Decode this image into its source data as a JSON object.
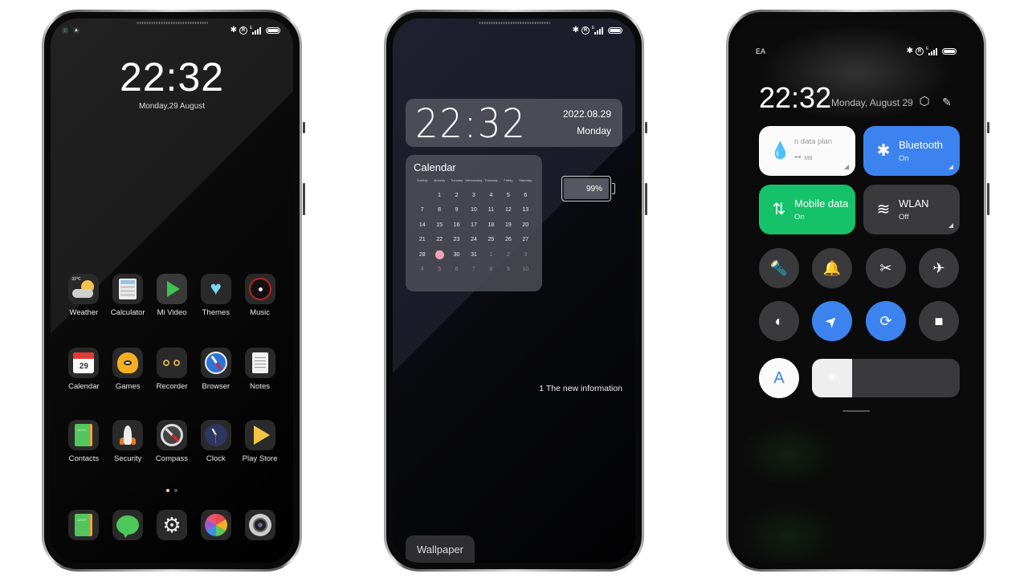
{
  "status_bar": {
    "bluetooth_icon": "bluetooth-icon",
    "registered_icon": "R",
    "network_type": "E",
    "battery_icon": "battery-icon"
  },
  "home_screen": {
    "notifications": [
      "phone-icon",
      "bell-icon"
    ],
    "clock": "22:32",
    "date": "Monday,29 August",
    "rows": [
      [
        {
          "label": "Weather",
          "icon": "weather-icon",
          "temp": "33°C"
        },
        {
          "label": "Calculator",
          "icon": "calculator-icon"
        },
        {
          "label": "Mi Video",
          "icon": "play-icon"
        },
        {
          "label": "Themes",
          "icon": "heart-icon"
        },
        {
          "label": "Music",
          "icon": "disc-icon"
        }
      ],
      [
        {
          "label": "Calendar",
          "icon": "calendar-icon",
          "day": "29"
        },
        {
          "label": "Games",
          "icon": "games-icon"
        },
        {
          "label": "Recorder",
          "icon": "recorder-icon"
        },
        {
          "label": "Browser",
          "icon": "compass-browser-icon"
        },
        {
          "label": "Notes",
          "icon": "notes-icon"
        }
      ],
      [
        {
          "label": "Contacts",
          "icon": "contacts-book-icon"
        },
        {
          "label": "Security",
          "icon": "rocket-icon"
        },
        {
          "label": "Compass",
          "icon": "compass-icon"
        },
        {
          "label": "Clock",
          "icon": "clock-icon"
        },
        {
          "label": "Play Store",
          "icon": "play-store-icon"
        }
      ]
    ],
    "page_dots": {
      "count": 2,
      "active": 0
    },
    "dock": [
      {
        "icon": "phone-book-icon"
      },
      {
        "icon": "message-icon"
      },
      {
        "icon": "settings-gear-icon",
        "glyph": "⚙"
      },
      {
        "icon": "photos-icon"
      },
      {
        "icon": "camera-icon"
      }
    ]
  },
  "lock_screen": {
    "clock_widget": {
      "time": "22:32",
      "date": "2022.08.29",
      "weekday": "Monday"
    },
    "calendar_widget": {
      "title": "Calendar",
      "headers": [
        "Sunday",
        "Monday",
        "Tuesday",
        "Wednesday",
        "Thursday",
        "Friday",
        "Saturday"
      ],
      "days": [
        [
          "",
          "1",
          "2",
          "3",
          "4",
          "5",
          "6"
        ],
        [
          "7",
          "8",
          "9",
          "10",
          "11",
          "12",
          "13"
        ],
        [
          "14",
          "15",
          "16",
          "17",
          "18",
          "19",
          "20"
        ],
        [
          "21",
          "22",
          "23",
          "24",
          "25",
          "26",
          "27"
        ],
        [
          "28",
          "29",
          "30",
          "31",
          "1",
          "2",
          "3"
        ],
        [
          "4",
          "5",
          "6",
          "7",
          "8",
          "9",
          "10"
        ]
      ],
      "today": "29"
    },
    "battery_widget": {
      "percent": "99%"
    },
    "notification_text": "1 The new information",
    "wallpaper_button": "Wallpaper"
  },
  "control_center": {
    "carrier": "EA",
    "clock": "22:32",
    "date": "Monday, August 29",
    "settings_icon": "⬡",
    "edit_icon": "✎",
    "tiles": {
      "data_plan": {
        "title": "n data plan",
        "value": "--",
        "unit": "MB",
        "icon": "💧"
      },
      "bluetooth": {
        "title": "Bluetooth",
        "status": "On",
        "icon": "✱"
      },
      "mobile_data": {
        "title": "Mobile data",
        "status": "On",
        "icon": "⇅"
      },
      "wlan": {
        "title": "WLAN",
        "status": "Off",
        "icon": "≋"
      }
    },
    "toggles": [
      {
        "name": "flashlight",
        "glyph": "🔦",
        "on": false
      },
      {
        "name": "silent",
        "glyph": "🔔",
        "on": false
      },
      {
        "name": "screenshot",
        "glyph": "✂",
        "on": false
      },
      {
        "name": "airplane",
        "glyph": "✈",
        "on": false
      },
      {
        "name": "dark-mode",
        "glyph": "◐",
        "on": false
      },
      {
        "name": "location",
        "glyph": "➤",
        "on": true
      },
      {
        "name": "rotation-lock",
        "glyph": "⟳",
        "on": true
      },
      {
        "name": "screen-recorder",
        "glyph": "■",
        "on": false
      }
    ],
    "auto_brightness": {
      "label": "A"
    },
    "brightness": {
      "level": 0.27,
      "icon": "☀"
    }
  }
}
